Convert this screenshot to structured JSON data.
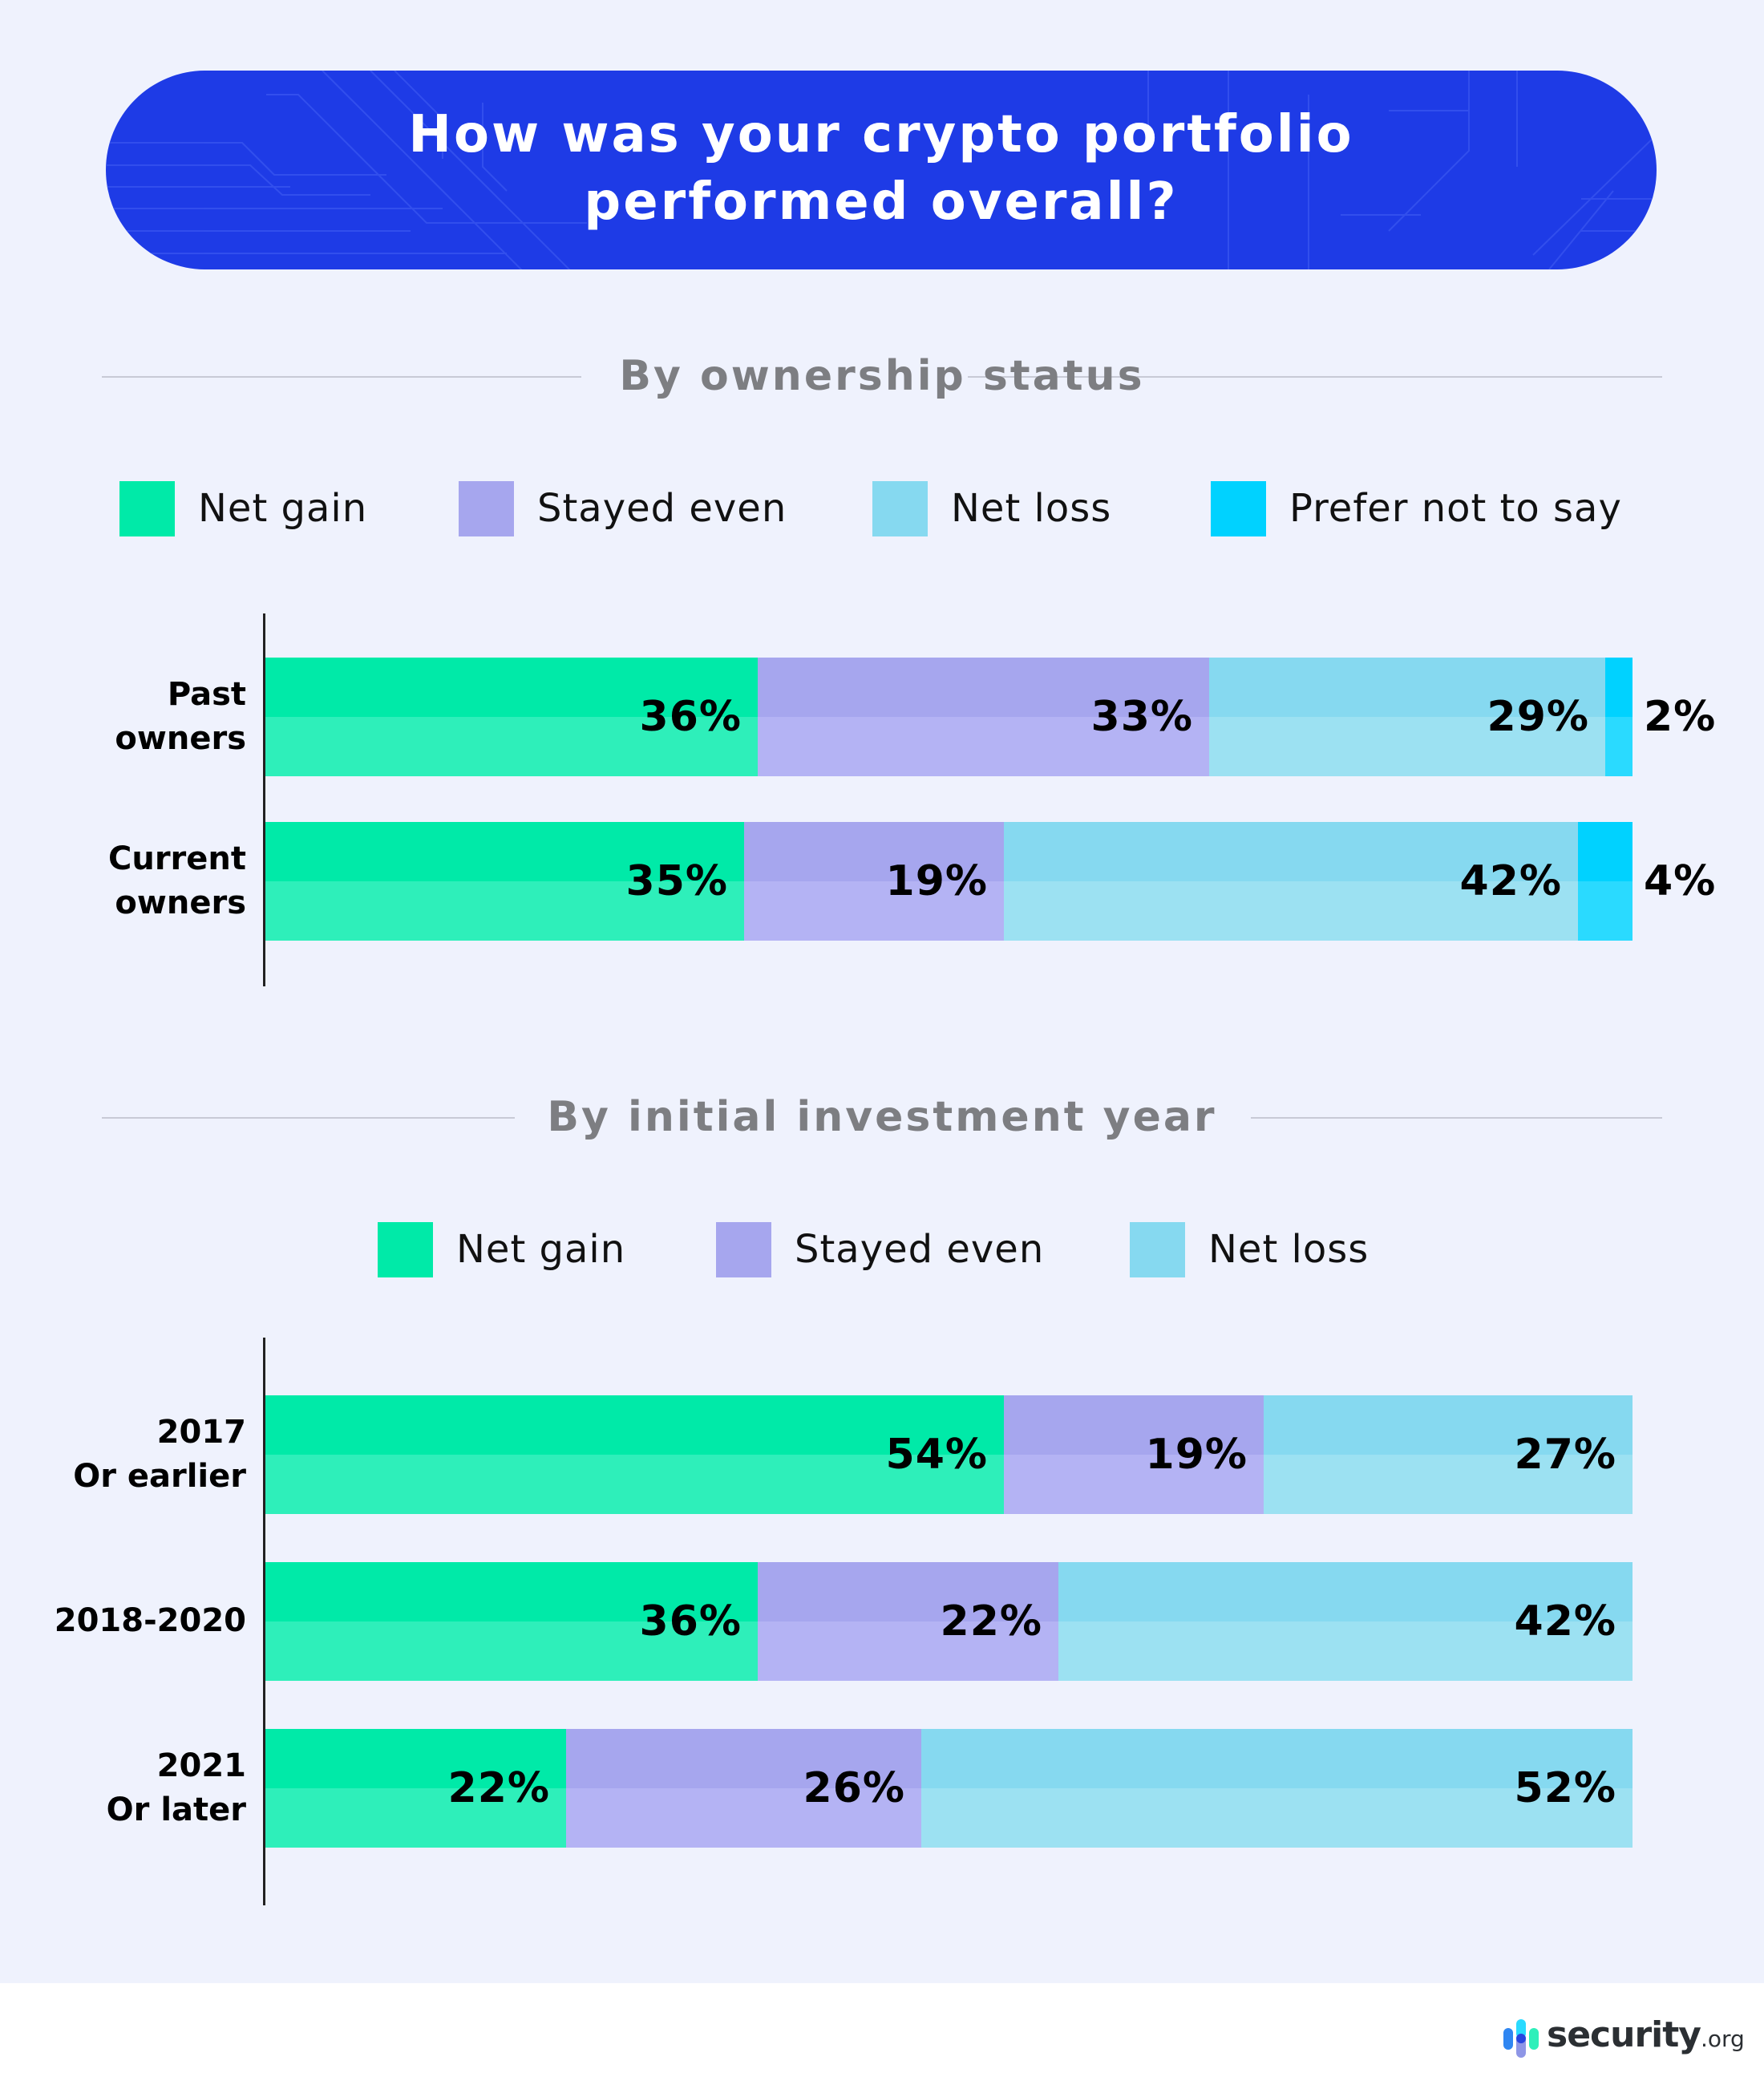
{
  "title": {
    "line1": "How was your crypto portfolio",
    "line2": "performed overall?"
  },
  "colors": {
    "background": "#EFF2FD",
    "title_bg": "#1E3BE6",
    "net_gain": {
      "top": "#00EAA8",
      "bottom": "#2EEFBA"
    },
    "stayed_even": {
      "top": "#A6A6EE",
      "bottom": "#B4B3F4"
    },
    "net_loss": {
      "top": "#86D9F0",
      "bottom": "#9CE1F2"
    },
    "prefer_not": {
      "top": "#00D2FF",
      "bottom": "#2ADAFF"
    },
    "section_title": "#7D7E82"
  },
  "footer": {
    "brand": "security",
    "tld": ".org",
    "logo_icon": "security-org-bars-icon"
  },
  "chart_data": [
    {
      "type": "bar",
      "orientation": "horizontal",
      "stacked": true,
      "title": "By ownership status",
      "categories": [
        "Past\nowners",
        "Current\nowners"
      ],
      "legend": [
        "Net gain",
        "Stayed even",
        "Net loss",
        "Prefer not to say"
      ],
      "legend_placement": "top",
      "series": [
        {
          "name": "Net gain",
          "key": "net_gain",
          "values": [
            36,
            35
          ]
        },
        {
          "name": "Stayed even",
          "key": "stayed_even",
          "values": [
            33,
            19
          ]
        },
        {
          "name": "Net loss",
          "key": "net_loss",
          "values": [
            29,
            42
          ]
        },
        {
          "name": "Prefer not to say",
          "key": "prefer_not",
          "values": [
            2,
            4
          ],
          "label_outside": true
        }
      ],
      "unit": "%",
      "xlim": [
        0,
        100
      ],
      "grid": false
    },
    {
      "type": "bar",
      "orientation": "horizontal",
      "stacked": true,
      "title": "By initial investment year",
      "categories": [
        "2017\nOr earlier",
        "2018-2020",
        "2021\nOr later"
      ],
      "legend": [
        "Net gain",
        "Stayed even",
        "Net loss"
      ],
      "legend_placement": "top",
      "series": [
        {
          "name": "Net gain",
          "key": "net_gain",
          "values": [
            54,
            36,
            22
          ]
        },
        {
          "name": "Stayed even",
          "key": "stayed_even",
          "values": [
            19,
            22,
            26
          ]
        },
        {
          "name": "Net loss",
          "key": "net_loss",
          "values": [
            27,
            42,
            52
          ]
        }
      ],
      "unit": "%",
      "xlim": [
        0,
        100
      ],
      "grid": false
    }
  ]
}
